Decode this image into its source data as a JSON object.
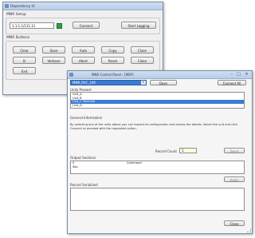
{
  "back_window": {
    "title": "Dependency UI",
    "mnr_section": {
      "label": "MNR Setup",
      "input_value": "1.1.1.1/111.11",
      "connect_label": "Connect",
      "start_label": "Start Logging"
    },
    "buttons_section": {
      "label": "MNR Buttons",
      "buttons": [
        "Clear",
        "Save",
        "Auto",
        "Copy",
        "Close",
        "B",
        "Verbose",
        "Abort",
        "Reset",
        "Clean",
        "Exit"
      ]
    }
  },
  "front_window": {
    "title": "MNR Control Panel - [MSP]",
    "combo_value": "MNR_RVC_100",
    "open_label": "Open",
    "connect_all_label": "Connect All",
    "units_label": "Units Present",
    "units": [
      "Unit_A",
      "Unit_B",
      "Unit_C Selected",
      "Unit_D"
    ],
    "description_label": "General Information",
    "description_text": "By selecting one of the units above you can inspect its configuration and review the details. Select the unit and click Connect to proceed with the requested action.",
    "record_label": "Record Count",
    "record_value": "1",
    "send_label": "Send",
    "output_label": "Output Sections",
    "output_rows": [
      {
        "c1": "S",
        "c2": "Command"
      },
      {
        "c1": "Skp",
        "c2": ""
      }
    ],
    "apply_label": "Apply",
    "record_section_label": "Record Serialized",
    "close_label": "Close"
  },
  "colors": {
    "accent": "#3a7bd5",
    "led": "#2d9e45",
    "titlebar": "#c6d9f0"
  }
}
